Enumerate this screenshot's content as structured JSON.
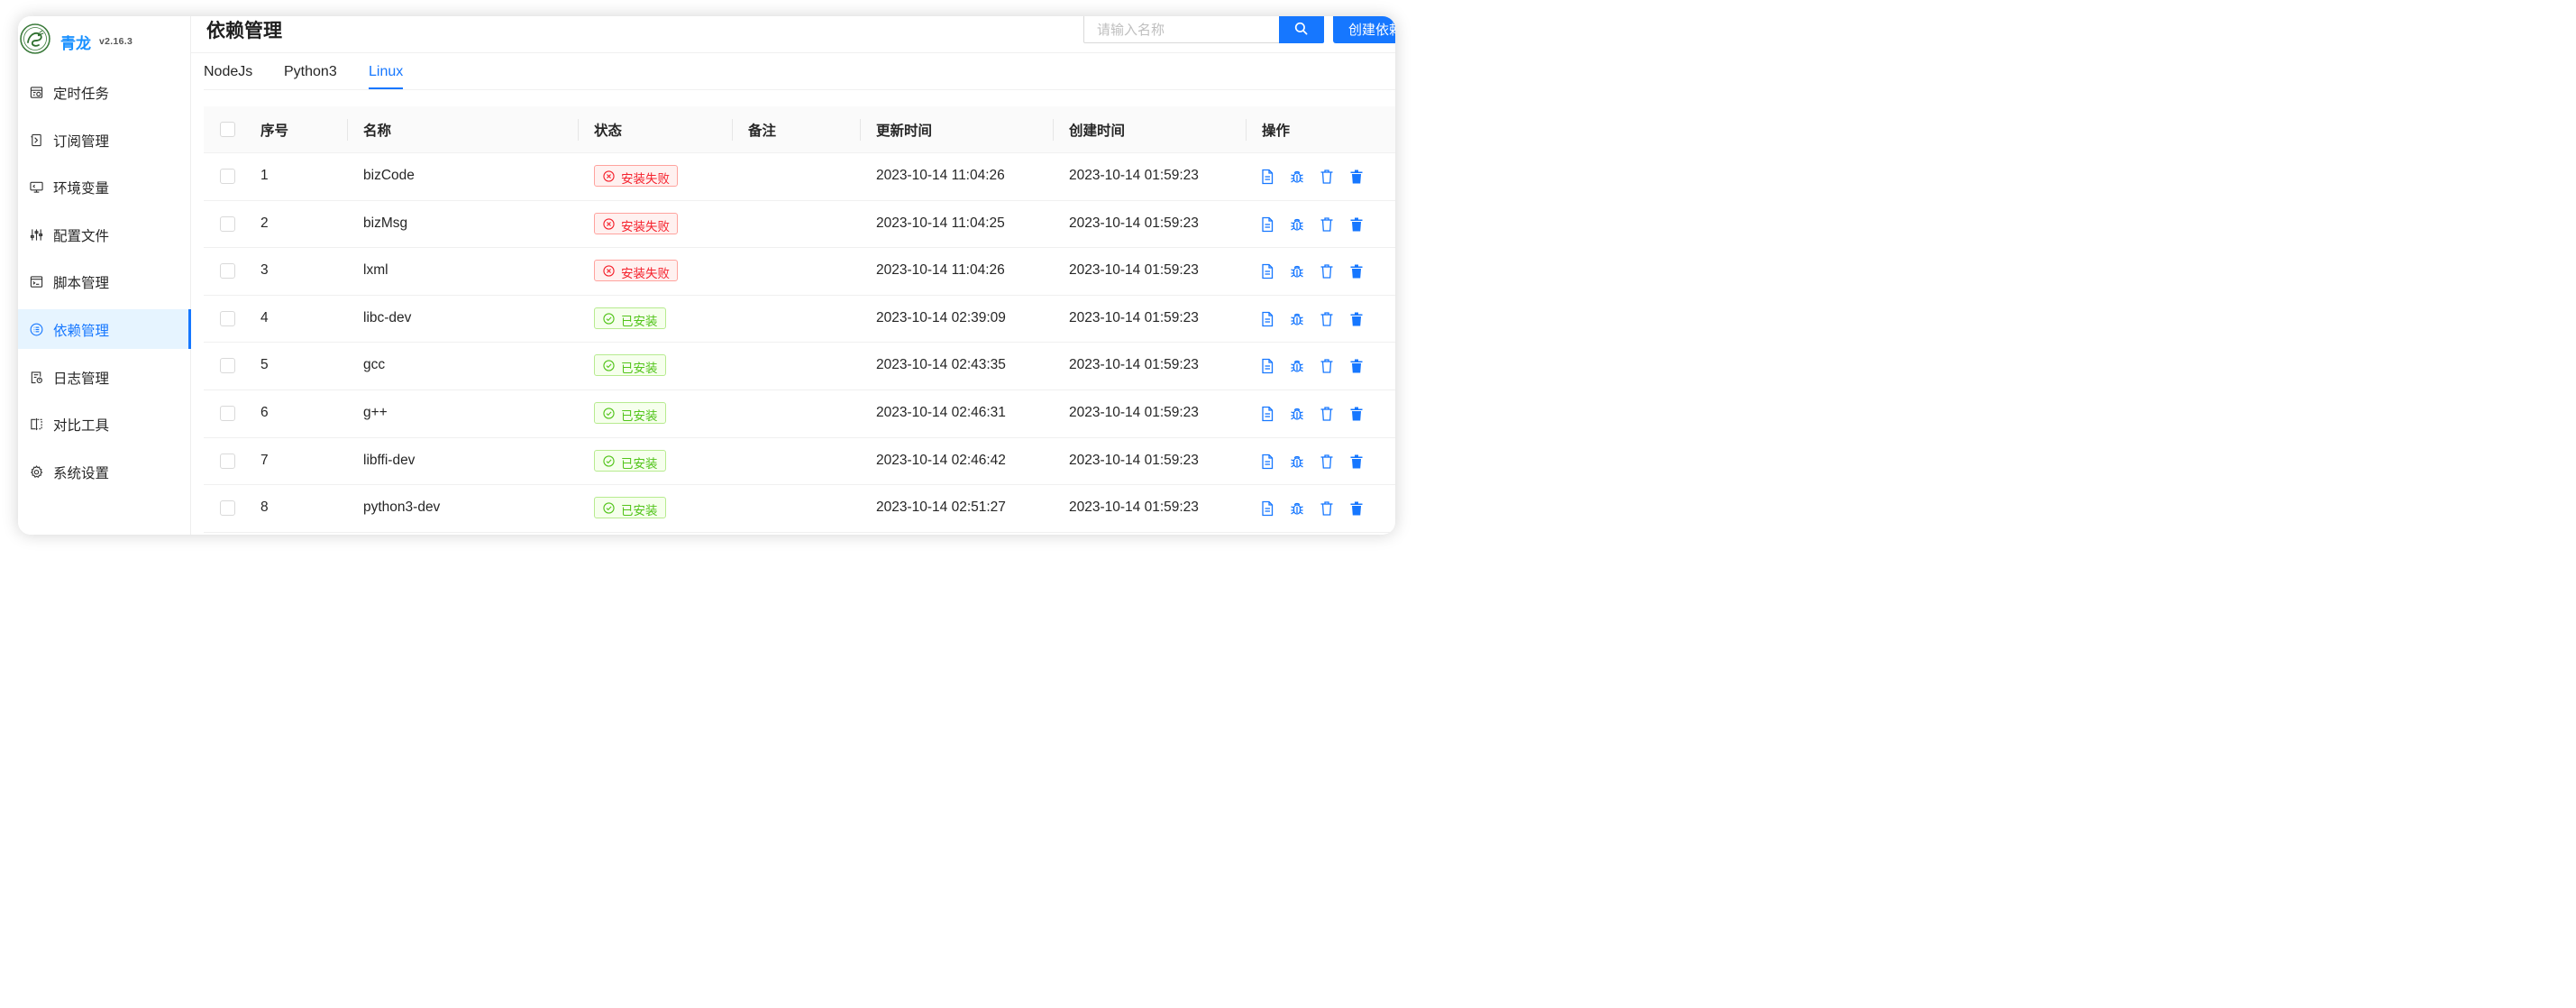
{
  "app": {
    "name": "青龙",
    "version": "v2.16.3"
  },
  "sidebar": {
    "items": [
      {
        "label": "定时任务",
        "icon": "calendar-clock-icon"
      },
      {
        "label": "订阅管理",
        "icon": "subscription-icon"
      },
      {
        "label": "环境变量",
        "icon": "monitor-icon"
      },
      {
        "label": "配置文件",
        "icon": "sliders-icon"
      },
      {
        "label": "脚本管理",
        "icon": "terminal-icon"
      },
      {
        "label": "依赖管理",
        "icon": "list-icon",
        "active": true
      },
      {
        "label": "日志管理",
        "icon": "log-file-icon"
      },
      {
        "label": "对比工具",
        "icon": "diff-icon"
      },
      {
        "label": "系统设置",
        "icon": "gear-icon"
      }
    ]
  },
  "header": {
    "title": "依赖管理",
    "search_placeholder": "请输入名称",
    "create_label": "创建依赖"
  },
  "tabs": [
    {
      "label": "NodeJs"
    },
    {
      "label": "Python3"
    },
    {
      "label": "Linux",
      "active": true
    }
  ],
  "table": {
    "columns": [
      "序号",
      "名称",
      "状态",
      "备注",
      "更新时间",
      "创建时间",
      "操作"
    ],
    "rows": [
      {
        "index": "1",
        "name": "bizCode",
        "status": "安装失败",
        "status_type": "fail",
        "remark": "",
        "updated": "2023-10-14 11:04:26",
        "created": "2023-10-14 01:59:23"
      },
      {
        "index": "2",
        "name": "bizMsg",
        "status": "安装失败",
        "status_type": "fail",
        "remark": "",
        "updated": "2023-10-14 11:04:25",
        "created": "2023-10-14 01:59:23"
      },
      {
        "index": "3",
        "name": "lxml",
        "status": "安装失败",
        "status_type": "fail",
        "remark": "",
        "updated": "2023-10-14 11:04:26",
        "created": "2023-10-14 01:59:23"
      },
      {
        "index": "4",
        "name": "libc-dev",
        "status": "已安装",
        "status_type": "ok",
        "remark": "",
        "updated": "2023-10-14 02:39:09",
        "created": "2023-10-14 01:59:23"
      },
      {
        "index": "5",
        "name": "gcc",
        "status": "已安装",
        "status_type": "ok",
        "remark": "",
        "updated": "2023-10-14 02:43:35",
        "created": "2023-10-14 01:59:23"
      },
      {
        "index": "6",
        "name": "g++",
        "status": "已安装",
        "status_type": "ok",
        "remark": "",
        "updated": "2023-10-14 02:46:31",
        "created": "2023-10-14 01:59:23"
      },
      {
        "index": "7",
        "name": "libffi-dev",
        "status": "已安装",
        "status_type": "ok",
        "remark": "",
        "updated": "2023-10-14 02:46:42",
        "created": "2023-10-14 01:59:23"
      },
      {
        "index": "8",
        "name": "python3-dev",
        "status": "已安装",
        "status_type": "ok",
        "remark": "",
        "updated": "2023-10-14 02:51:27",
        "created": "2023-10-14 01:59:23"
      }
    ],
    "actions": [
      {
        "icon": "file-text-icon",
        "name": "view-log"
      },
      {
        "icon": "bug-icon",
        "name": "reinstall"
      },
      {
        "icon": "trash-outline-icon",
        "name": "uninstall"
      },
      {
        "icon": "trash-filled-icon",
        "name": "delete"
      }
    ]
  },
  "colors": {
    "primary": "#1677ff",
    "fail": "#f5222d",
    "success": "#52c41a"
  }
}
